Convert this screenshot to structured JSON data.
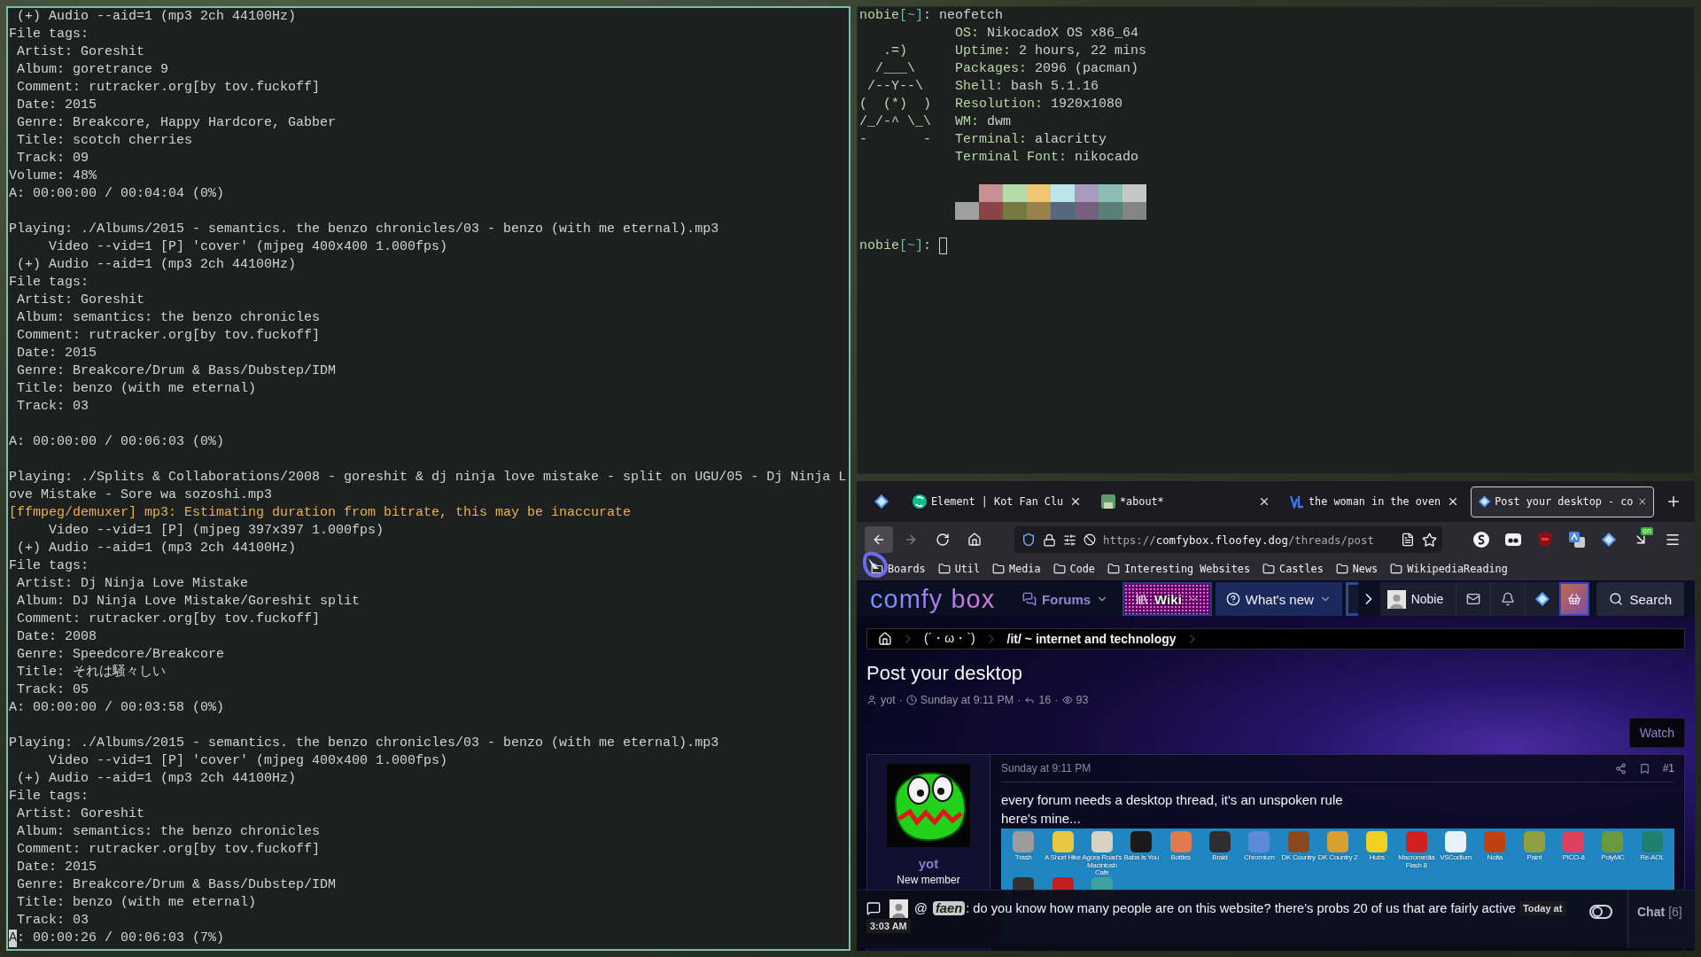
{
  "left_terminal": {
    "focused": true,
    "lines": [
      {
        "kind": "text",
        "text": " (+) Audio --aid=1 (mp3 2ch 44100Hz)"
      },
      {
        "kind": "text",
        "text": "File tags:"
      },
      {
        "kind": "text",
        "text": " Artist: Goreshit"
      },
      {
        "kind": "text",
        "text": " Album: goretrance 9"
      },
      {
        "kind": "text",
        "text": " Comment: rutracker.org[by tov.fuckoff]"
      },
      {
        "kind": "text",
        "text": " Date: 2015"
      },
      {
        "kind": "text",
        "text": " Genre: Breakcore, Happy Hardcore, Gabber"
      },
      {
        "kind": "text",
        "text": " Title: scotch cherries"
      },
      {
        "kind": "text",
        "text": " Track: 09"
      },
      {
        "kind": "text",
        "text": "Volume: 48%"
      },
      {
        "kind": "text",
        "text": "A: 00:00:00 / 00:04:04 (0%)"
      },
      {
        "kind": "blank"
      },
      {
        "kind": "text",
        "text": "Playing: ./Albums/2015 - semantics. the benzo chronicles/03 - benzo (with me eternal).mp3"
      },
      {
        "kind": "text",
        "text": "     Video --vid=1 [P] 'cover' (mjpeg 400x400 1.000fps)"
      },
      {
        "kind": "text",
        "text": " (+) Audio --aid=1 (mp3 2ch 44100Hz)"
      },
      {
        "kind": "text",
        "text": "File tags:"
      },
      {
        "kind": "text",
        "text": " Artist: Goreshit"
      },
      {
        "kind": "text",
        "text": " Album: semantics: the benzo chronicles"
      },
      {
        "kind": "text",
        "text": " Comment: rutracker.org[by tov.fuckoff]"
      },
      {
        "kind": "text",
        "text": " Date: 2015"
      },
      {
        "kind": "text",
        "text": " Genre: Breakcore/Drum & Bass/Dubstep/IDM"
      },
      {
        "kind": "text",
        "text": " Title: benzo (with me eternal)"
      },
      {
        "kind": "text",
        "text": " Track: 03"
      },
      {
        "kind": "blank"
      },
      {
        "kind": "text",
        "text": "A: 00:00:00 / 00:06:03 (0%)"
      },
      {
        "kind": "blank"
      },
      {
        "kind": "text",
        "text": "Playing: ./Splits & Collaborations/2008 - goreshit & dj ninja love mistake - split on UGU/05 - Dj Ninja L"
      },
      {
        "kind": "text",
        "text": "ove Mistake - Sore wa sozoshi.mp3"
      },
      {
        "kind": "warning",
        "text": "[ffmpeg/demuxer] mp3: Estimating duration from bitrate, this may be inaccurate"
      },
      {
        "kind": "text",
        "text": "     Video --vid=1 [P] (mjpeg 397x397 1.000fps)"
      },
      {
        "kind": "text",
        "text": " (+) Audio --aid=1 (mp3 2ch 44100Hz)"
      },
      {
        "kind": "text",
        "text": "File tags:"
      },
      {
        "kind": "text",
        "text": " Artist: Dj Ninja Love Mistake"
      },
      {
        "kind": "text",
        "text": " Album: DJ Ninja Love Mistake/Goreshit split"
      },
      {
        "kind": "text",
        "text": " Comment: rutracker.org[by tov.fuckoff]"
      },
      {
        "kind": "text",
        "text": " Date: 2008"
      },
      {
        "kind": "text",
        "text": " Genre: Speedcore/Breakcore"
      },
      {
        "kind": "text",
        "text": " Title: それは騒々しい"
      },
      {
        "kind": "text",
        "text": " Track: 05"
      },
      {
        "kind": "text",
        "text": "A: 00:00:00 / 00:03:58 (0%)"
      },
      {
        "kind": "blank"
      },
      {
        "kind": "text",
        "text": "Playing: ./Albums/2015 - semantics. the benzo chronicles/03 - benzo (with me eternal).mp3"
      },
      {
        "kind": "text",
        "text": "     Video --vid=1 [P] 'cover' (mjpeg 400x400 1.000fps)"
      },
      {
        "kind": "text",
        "text": " (+) Audio --aid=1 (mp3 2ch 44100Hz)"
      },
      {
        "kind": "text",
        "text": "File tags:"
      },
      {
        "kind": "text",
        "text": " Artist: Goreshit"
      },
      {
        "kind": "text",
        "text": " Album: semantics: the benzo chronicles"
      },
      {
        "kind": "text",
        "text": " Comment: rutracker.org[by tov.fuckoff]"
      },
      {
        "kind": "text",
        "text": " Date: 2015"
      },
      {
        "kind": "text",
        "text": " Genre: Breakcore/Drum & Bass/Dubstep/IDM"
      },
      {
        "kind": "text",
        "text": " Title: benzo (with me eternal)"
      },
      {
        "kind": "text",
        "text": " Track: 03"
      },
      {
        "kind": "cursor",
        "text": "A: 00:00:26 / 00:06:03 (7%)"
      }
    ]
  },
  "right_terminal": {
    "focused": false,
    "command_line": {
      "user": "nobie",
      "path": "[~]",
      "symbol": ":",
      "command": "neofetch"
    },
    "info": [
      {
        "key": "OS:",
        "value": "NikocadoX OS x86_64"
      },
      {
        "art": "   .=)",
        "key": "Uptime:",
        "value": "2 hours, 22 mins"
      },
      {
        "art": "  /___\\",
        "key": "Packages:",
        "value": "2096 (pacman)"
      },
      {
        "art": " /--Y--\\",
        "key": "Shell:",
        "value": "bash 5.1.16"
      },
      {
        "art": "(  (*)  )",
        "key": "Resolution:",
        "value": "1920x1080"
      },
      {
        "art": "/_/-^ \\_\\",
        "key": "WM:",
        "value": "dwm"
      },
      {
        "art": "-       -",
        "key": "Terminal:",
        "value": "alacritty"
      },
      {
        "key": "Terminal Font:",
        "value": "nikocado"
      }
    ],
    "palette": [
      {
        "swatches": [
          {
            "color": "#c89191"
          },
          {
            "color": "#b5dba8"
          },
          {
            "color": "#f0c674"
          },
          {
            "color": "#bde6e8"
          },
          {
            "color": "#a89bbd"
          },
          {
            "color": "#8bbdb5"
          },
          {
            "color": "#c5c8c6"
          }
        ]
      },
      {
        "swatches": [
          {
            "color": "#a0a0a0"
          },
          {
            "color": "#8b4343"
          },
          {
            "color": "#767a42"
          },
          {
            "color": "#9a8049"
          },
          {
            "color": "#546880"
          },
          {
            "color": "#77607e"
          },
          {
            "color": "#5a7f78"
          },
          {
            "color": "#828583"
          }
        ]
      }
    ],
    "prompt": {
      "user": "nobie",
      "path": "[~]",
      "symbol": ":"
    }
  },
  "browser": {
    "tabs": [
      {
        "kind": "pinned",
        "selected": false
      },
      {
        "kind": "page",
        "title": "Element | Kot Fan Clu",
        "selected": false
      },
      {
        "kind": "page",
        "title": "*about*",
        "selected": false
      },
      {
        "kind": "page",
        "title": "the woman in the oven",
        "selected": false
      },
      {
        "kind": "page",
        "title": "Post your desktop - co",
        "selected": true
      }
    ],
    "url": {
      "scheme": "https://",
      "domain": "comfybox.floofey.dog",
      "path": "/threads/post"
    },
    "extension_badge": "on",
    "bookmarks": [
      {
        "label": "Boards"
      },
      {
        "label": "Util"
      },
      {
        "label": "Media"
      },
      {
        "label": "Code"
      },
      {
        "label": "Interesting Websites"
      },
      {
        "label": "Castles"
      },
      {
        "label": "News"
      },
      {
        "label": "WikipediaReading"
      }
    ],
    "forum": {
      "logo": "comfy box",
      "nav": [
        {
          "label": "Forums",
          "kind": "text",
          "selected": true,
          "dropdown": true
        },
        {
          "label": "Wiki",
          "kind": "glitter",
          "selected": false,
          "dropdown": true
        },
        {
          "label": "What's new",
          "kind": "highlighted",
          "selected": false,
          "dropdown": true
        }
      ],
      "user": "Nobie",
      "search": "Search",
      "breadcrumbs": [
        "(´・ω・`)",
        "/it/ ~ internet and technology"
      ],
      "thread": {
        "title": "Post your desktop",
        "meta": [
          {
            "kind": "author",
            "text": "yot"
          },
          {
            "kind": "date",
            "text": "Sunday at 9:11 PM"
          },
          {
            "kind": "replies",
            "text": "16"
          },
          {
            "kind": "views",
            "text": "93"
          }
        ],
        "separators": [
          "·",
          "·",
          "·"
        ],
        "watch": "Watch"
      },
      "post": {
        "author": "yot",
        "role": "New member",
        "date": "Sunday at 9:11 PM",
        "number": "#1",
        "lines": [
          "every forum needs a desktop thread, it's an unspoken rule",
          "here's mine..."
        ],
        "attachment": {
          "icons": [
            {
              "label": "Trash",
              "color": "#9c9c9c"
            },
            {
              "label": "A Short Hike",
              "color": "#e8c840"
            },
            {
              "label": "Agora Road's Macintosh Cafe",
              "color": "#d8d2c4"
            },
            {
              "label": "Baba Is You",
              "color": "#1a1a1a"
            },
            {
              "label": "Bottles",
              "color": "#e07a50"
            },
            {
              "label": "Braid",
              "color": "#2e2e2e"
            },
            {
              "label": "Chromium",
              "color": "#5a8ad8"
            },
            {
              "label": "DK Country",
              "color": "#8a4a20"
            },
            {
              "label": "DK Country 2",
              "color": "#d8a030"
            },
            {
              "label": "Hubs",
              "color": "#f0d020"
            },
            {
              "label": "Macromedia Flash 8",
              "color": "#d02020"
            },
            {
              "label": "VSCodium",
              "color": "#e8f2f8"
            },
            {
              "label": "Noita",
              "color": "#c04010"
            },
            {
              "label": "Paint",
              "color": "#90a040"
            },
            {
              "label": "PICO-8",
              "color": "#e04060"
            },
            {
              "label": "PolyMC",
              "color": "#6a9a40"
            },
            {
              "label": "Re-AOL",
              "color": "#208070"
            },
            {
              "color": "#303030"
            },
            {
              "color": "#c02020"
            },
            {
              "color": "#40a0a0"
            }
          ]
        }
      },
      "chat": {
        "mention": "@",
        "user": "faen",
        "text": ": do you know how many people are on this website? there's probs 20 of us that are fairly active",
        "time_tag": "Today at",
        "time": "3:03 AM",
        "title": "Chat",
        "count": "[6]"
      }
    }
  }
}
